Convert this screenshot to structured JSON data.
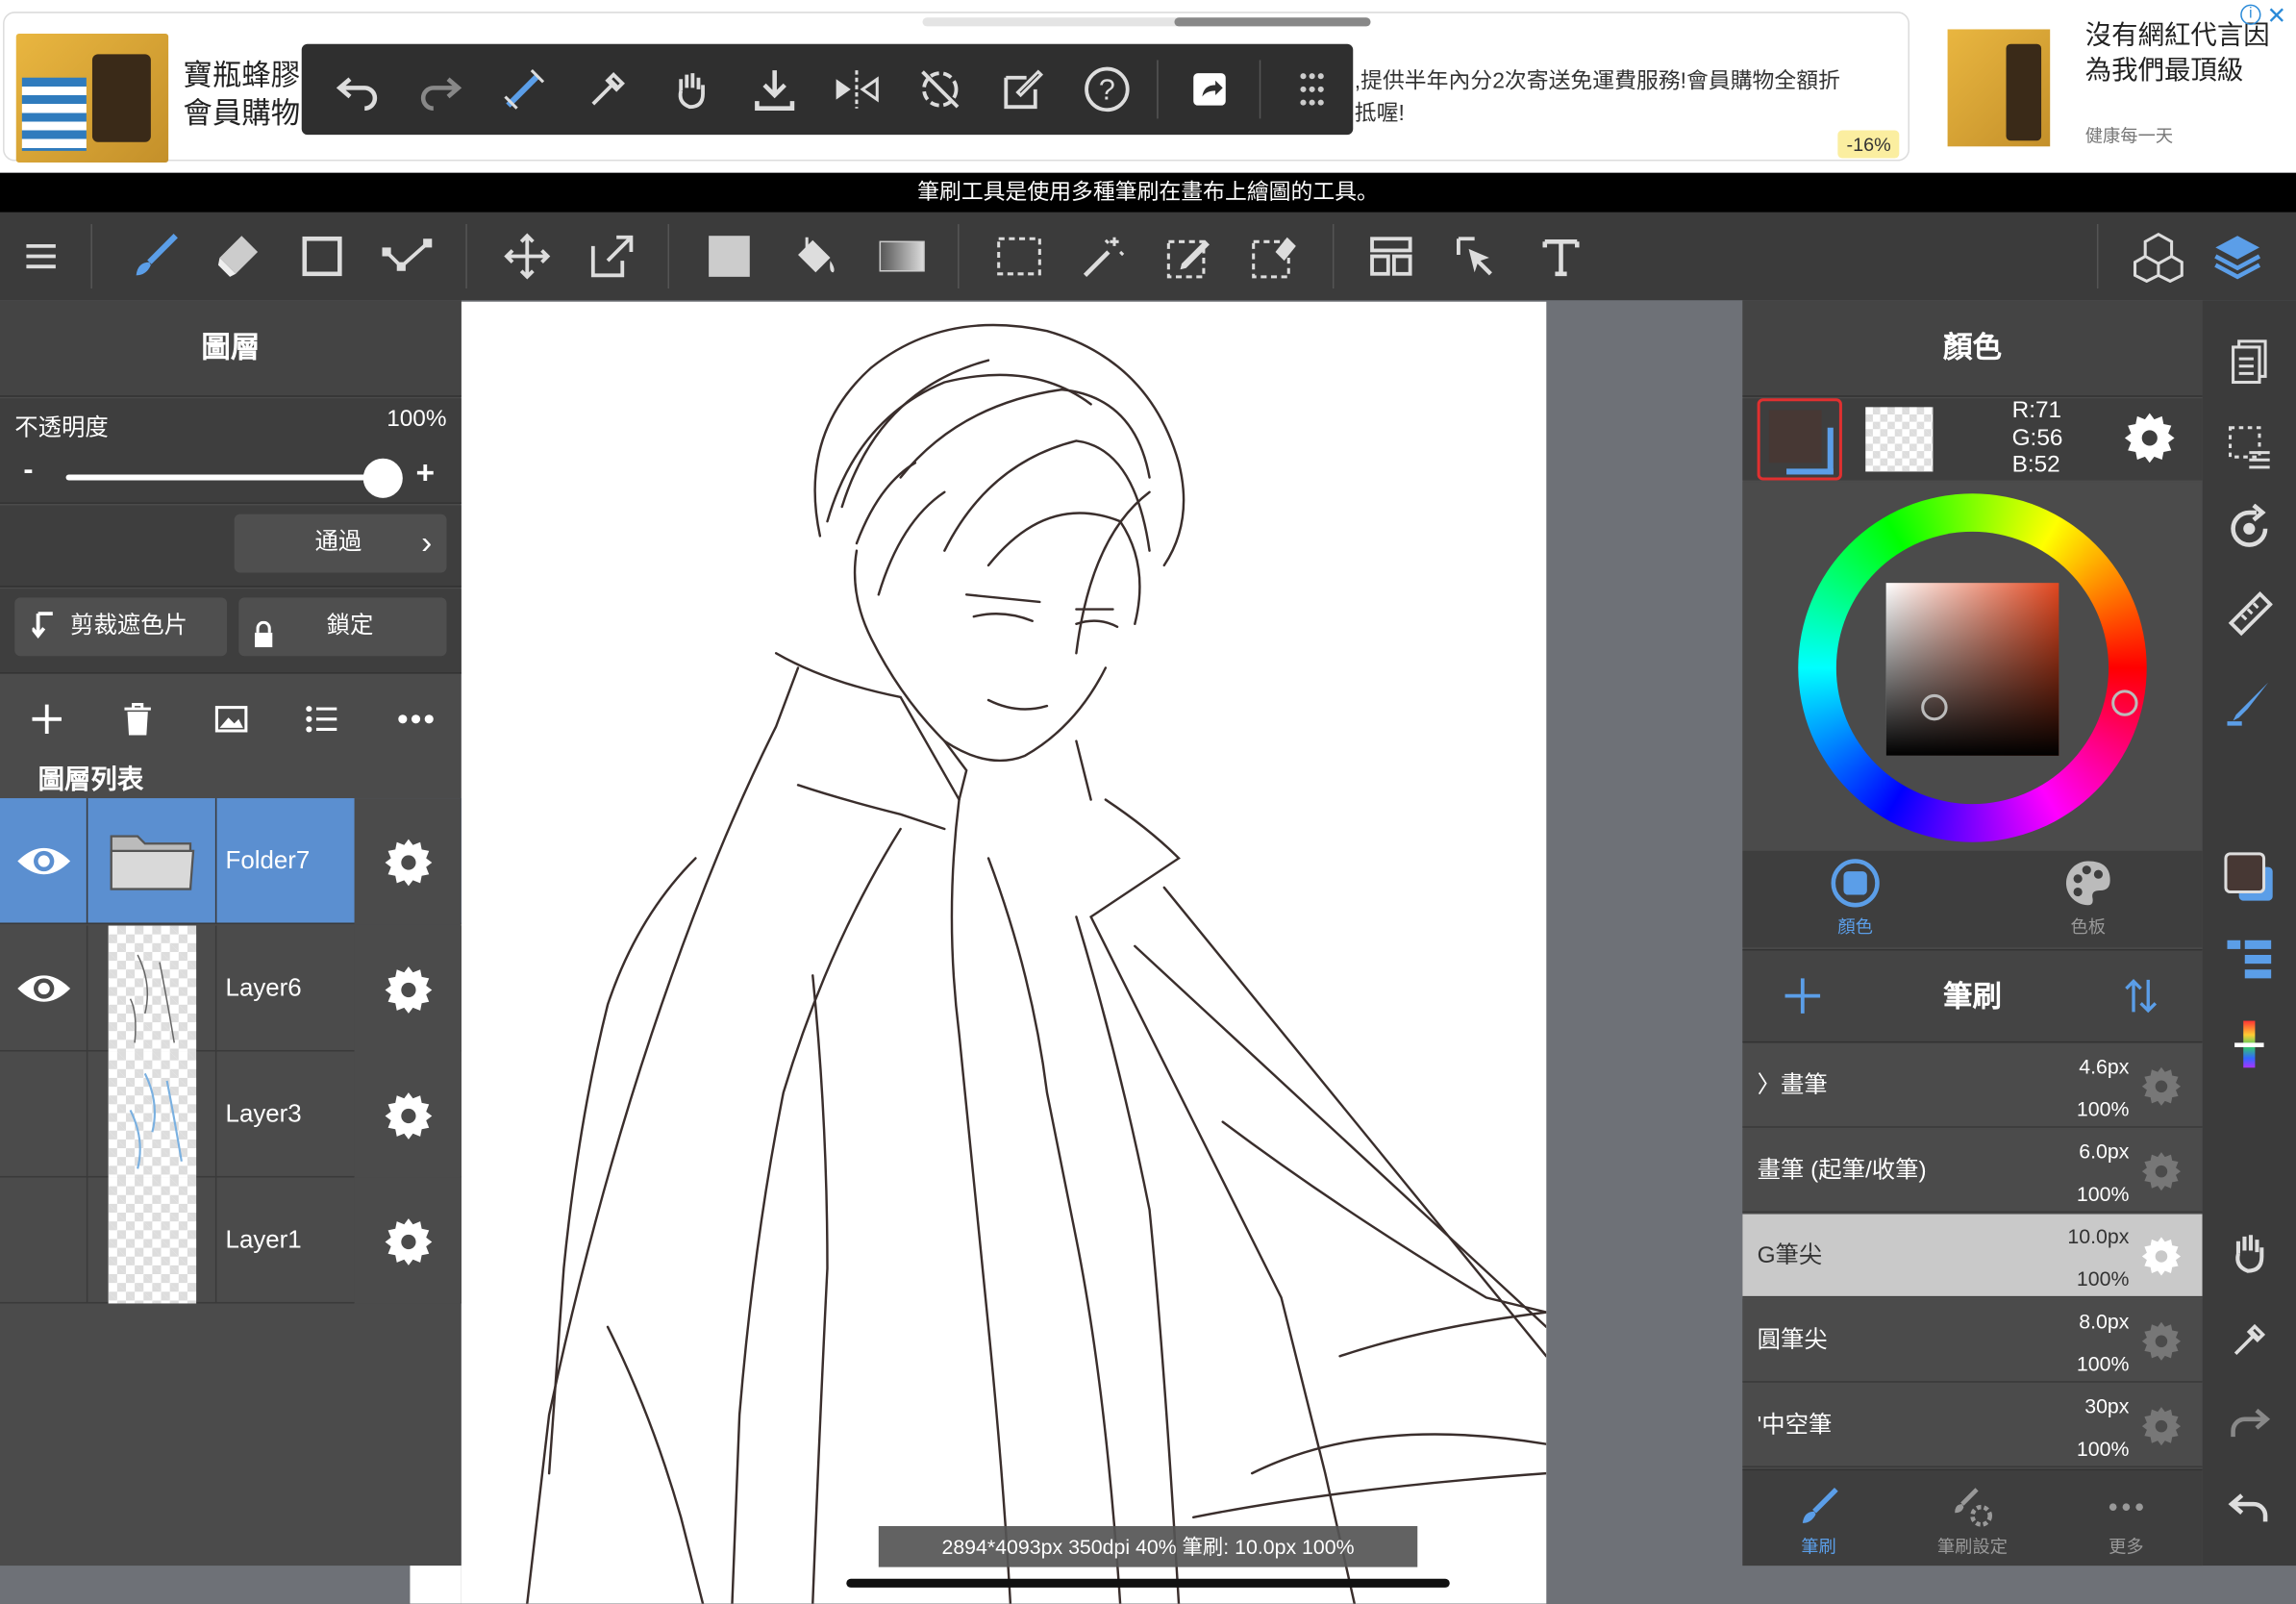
{
  "ad": {
    "title": "寶瓶蜂膠 會員購物",
    "desc": ",提供半年內分2次寄送免運費服務!會員購物全額折抵喔!",
    "discount": "-16%",
    "ad2_title": "沒有網紅代言因為我們最頂級",
    "ad2_sub": "健康每一天",
    "info_icon": "i",
    "close_icon": "✕"
  },
  "hint": "筆刷工具是使用多種筆刷在畫布上繪圖的工具。",
  "layers_panel": {
    "title": "圖層",
    "opacity_label": "不透明度",
    "opacity_value": "100%",
    "opacity_fraction": 1.0,
    "minus": "-",
    "plus": "+",
    "blend_mode": "通過",
    "clip_label": "剪裁遮色片",
    "lock_label": "鎖定",
    "list_label": "圖層列表",
    "layers": [
      {
        "name": "Folder7",
        "selected": true
      },
      {
        "name": "Layer6",
        "selected": false
      },
      {
        "name": "Layer3",
        "selected": false
      },
      {
        "name": "Layer1",
        "selected": false
      }
    ]
  },
  "color_panel": {
    "title": "顏色",
    "r": "R:71",
    "g": "G:56",
    "b": "B:52",
    "tab_color": "顏色",
    "tab_palette": "色板",
    "main_color": "#473834"
  },
  "brush_panel": {
    "title": "筆刷",
    "brushes": [
      {
        "name": "〉畫筆",
        "size": "4.6px",
        "opacity": "100%",
        "selected": false
      },
      {
        "name": "畫筆 (起筆/收筆)",
        "size": "6.0px",
        "opacity": "100%",
        "selected": false
      },
      {
        "name": "G筆尖",
        "size": "10.0px",
        "opacity": "100%",
        "selected": true
      },
      {
        "name": "圓筆尖",
        "size": "8.0px",
        "opacity": "100%",
        "selected": false
      },
      {
        "name": "'中空筆",
        "size": "30px",
        "opacity": "100%",
        "selected": false
      }
    ],
    "tab_brush": "筆刷",
    "tab_brush_settings": "筆刷設定",
    "tab_more": "更多"
  },
  "status": "2894*4093px 350dpi 40% 筆刷: 10.0px 100%",
  "colors": {
    "accent": "#5b8fd0",
    "toolbar_bg": "#3b3b3b",
    "panel_bg": "#4b4b4b"
  }
}
